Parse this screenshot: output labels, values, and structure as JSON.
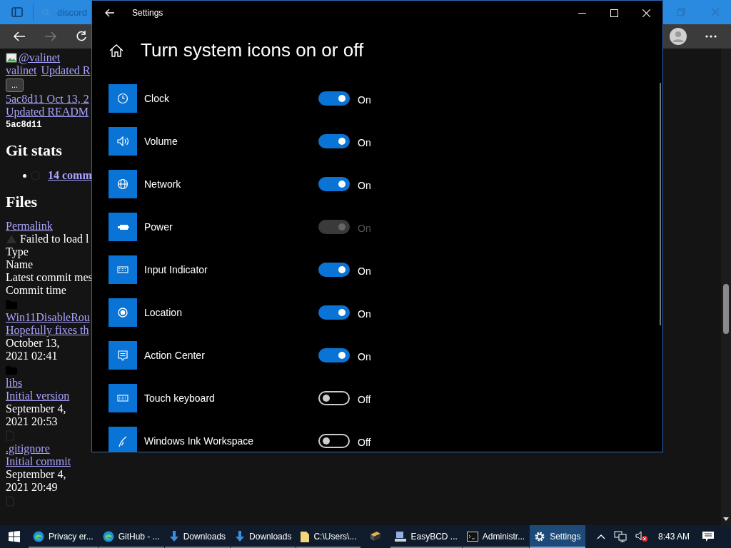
{
  "browser": {
    "search": {
      "value": "discord"
    },
    "page_lines": [
      {
        "kind": "image_link",
        "text": "@valinet"
      },
      {
        "kind": "links",
        "texts": [
          "valinet",
          "Updated R"
        ]
      },
      {
        "kind": "button",
        "text": "..."
      },
      {
        "kind": "link",
        "text": "5ac8d11 Oct 13, 2"
      },
      {
        "kind": "link",
        "text": "Updated READM"
      },
      {
        "kind": "code",
        "text": "5ac8d11"
      },
      {
        "kind": "heading",
        "text": "Git stats"
      },
      {
        "kind": "bullet_link",
        "text": "14 comm"
      },
      {
        "kind": "heading",
        "text": "Files"
      },
      {
        "kind": "link",
        "text": "Permalink"
      },
      {
        "kind": "notice",
        "text": "Failed to load l"
      },
      {
        "kind": "text",
        "text": "Type"
      },
      {
        "kind": "text",
        "text": "Name"
      },
      {
        "kind": "text",
        "text": "Latest commit mes"
      },
      {
        "kind": "text",
        "text": "Commit time"
      },
      {
        "kind": "folder"
      },
      {
        "kind": "link",
        "text": "Win11DisableRou"
      },
      {
        "kind": "link",
        "text": "Hopefully fixes th"
      },
      {
        "kind": "text",
        "text": "October 13,"
      },
      {
        "kind": "text",
        "text": "2021 02:41"
      },
      {
        "kind": "folder"
      },
      {
        "kind": "link",
        "text": "libs"
      },
      {
        "kind": "link",
        "text": "Initial version"
      },
      {
        "kind": "text",
        "text": "September 4,"
      },
      {
        "kind": "text",
        "text": "2021 20:53"
      },
      {
        "kind": "file"
      },
      {
        "kind": "link",
        "text": ".gitignore"
      },
      {
        "kind": "link",
        "text": "Initial commit"
      },
      {
        "kind": "text",
        "text": "September 4,"
      },
      {
        "kind": "text",
        "text": "2021 20:49"
      },
      {
        "kind": "file"
      }
    ]
  },
  "settings": {
    "window_title": "Settings",
    "page_title": "Turn system icons on or off",
    "items": [
      {
        "label": "Clock",
        "on": true,
        "disabled": false,
        "state": "On"
      },
      {
        "label": "Volume",
        "on": true,
        "disabled": false,
        "state": "On"
      },
      {
        "label": "Network",
        "on": true,
        "disabled": false,
        "state": "On"
      },
      {
        "label": "Power",
        "on": true,
        "disabled": true,
        "state": "On"
      },
      {
        "label": "Input Indicator",
        "on": true,
        "disabled": false,
        "state": "On"
      },
      {
        "label": "Location",
        "on": true,
        "disabled": false,
        "state": "On"
      },
      {
        "label": "Action Center",
        "on": true,
        "disabled": false,
        "state": "On"
      },
      {
        "label": "Touch keyboard",
        "on": false,
        "disabled": false,
        "state": "Off"
      },
      {
        "label": "Windows Ink Workspace",
        "on": false,
        "disabled": false,
        "state": "Off"
      }
    ]
  },
  "taskbar": {
    "apps": [
      {
        "kind": "edge",
        "label": "Privacy er...",
        "selected": false
      },
      {
        "kind": "edge",
        "label": "GitHub - ...",
        "selected": false
      },
      {
        "kind": "download",
        "label": "Downloads",
        "selected": false
      },
      {
        "kind": "download",
        "label": "Downloads",
        "selected": false
      },
      {
        "kind": "folder",
        "label": "C:\\Users\\...",
        "selected": false
      },
      {
        "kind": "box",
        "selected": false
      },
      {
        "kind": "disk",
        "label": "EasyBCD ...",
        "selected": false
      },
      {
        "kind": "console",
        "label": "Administr...",
        "selected": false
      },
      {
        "kind": "gear",
        "label": "Settings",
        "selected": true
      }
    ],
    "clock": "8:43 AM"
  }
}
